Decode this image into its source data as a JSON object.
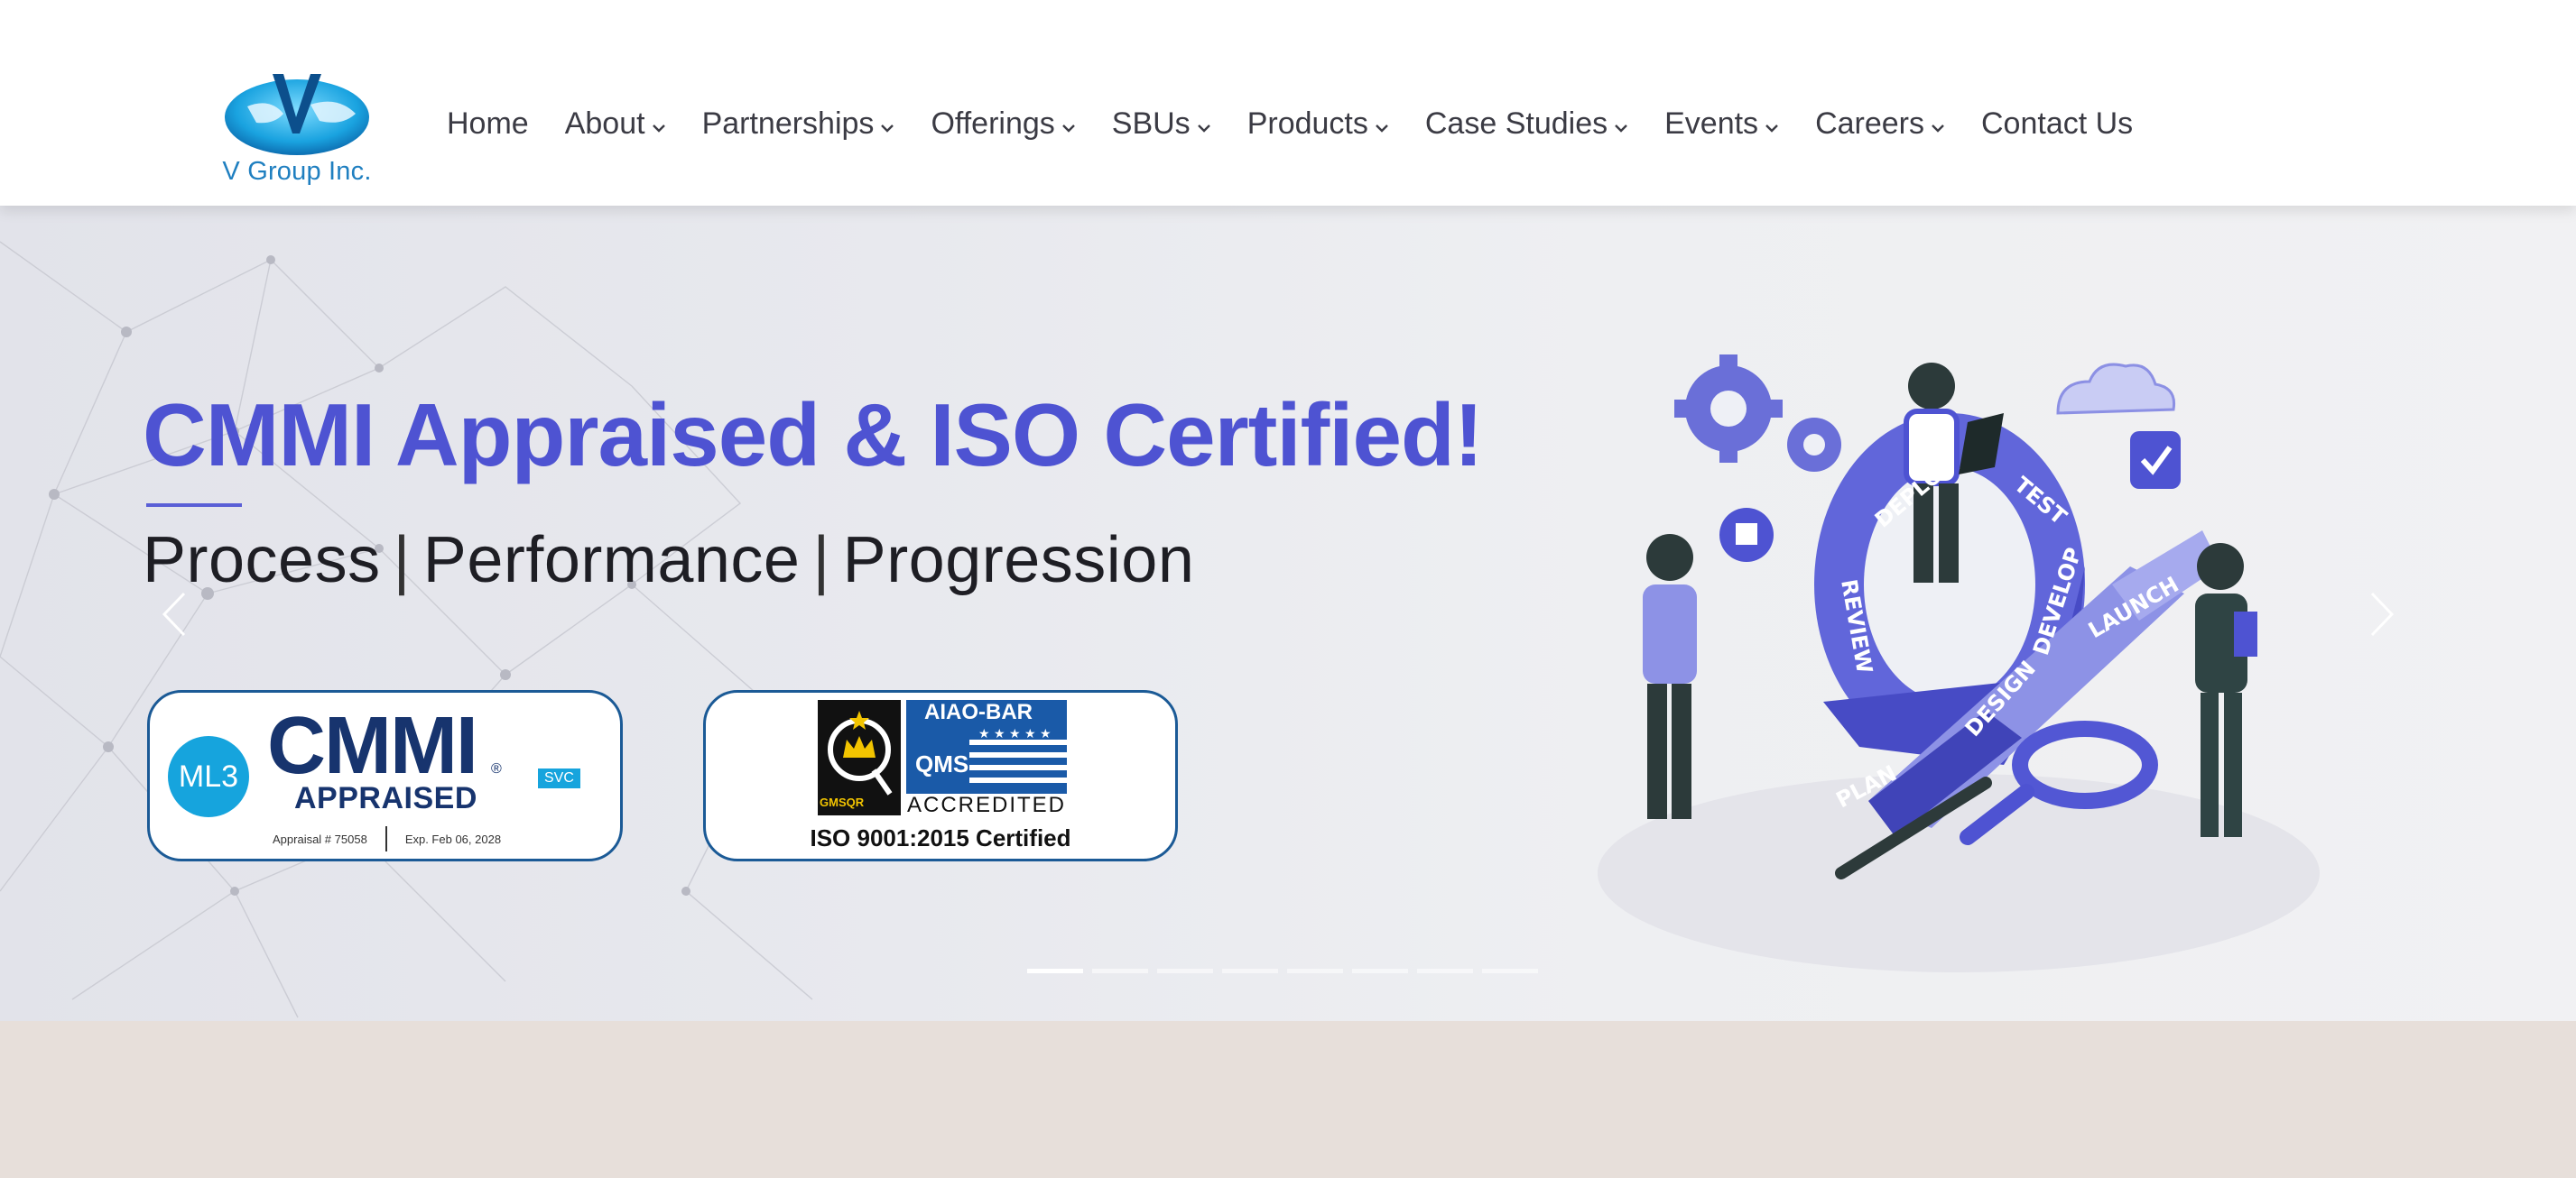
{
  "brand": {
    "logo_text": "V Group Inc.",
    "logo_icon": "globe-v-logo"
  },
  "nav": {
    "items": [
      {
        "label": "Home",
        "has_dropdown": false
      },
      {
        "label": "About",
        "has_dropdown": true
      },
      {
        "label": "Partnerships",
        "has_dropdown": true
      },
      {
        "label": "Offerings",
        "has_dropdown": true
      },
      {
        "label": "SBUs",
        "has_dropdown": true
      },
      {
        "label": "Products",
        "has_dropdown": true
      },
      {
        "label": "Case Studies",
        "has_dropdown": true
      },
      {
        "label": "Events",
        "has_dropdown": true
      },
      {
        "label": "Careers",
        "has_dropdown": true
      },
      {
        "label": "Contact Us",
        "has_dropdown": false
      }
    ]
  },
  "hero": {
    "title": "CMMI Appraised & ISO Certified!",
    "subtitle_parts": [
      "Process",
      "Performance",
      "Progression"
    ],
    "separator": "|",
    "slide_count": 8,
    "active_slide": 1
  },
  "cmmi_badge": {
    "level": "ML3",
    "word": "CMMI",
    "registered": "®",
    "appraised": "APPRAISED",
    "tag": "SVC",
    "appraisal_no": "Appraisal # 75058",
    "expiry": "Exp. Feb 06, 2028"
  },
  "iso_badge": {
    "body": "AIAO-BAR",
    "qms": "QMS",
    "gmsqr": "GMSQR",
    "accredited": "ACCREDITED",
    "certified": "ISO 9001:2015 Certified"
  },
  "illustration": {
    "ring_labels": [
      "PLAN",
      "DESIGN",
      "DEVELOP",
      "TEST",
      "DEPLOY",
      "REVIEW"
    ],
    "ramp_label": "LAUNCH"
  },
  "colors": {
    "accent": "#4e53d2",
    "nav_text": "#3b3b44",
    "badge_border": "#1b5a96",
    "cmmi_navy": "#17346e",
    "cmmi_cyan": "#16a4dd",
    "lower_band": "#e7dfda"
  }
}
